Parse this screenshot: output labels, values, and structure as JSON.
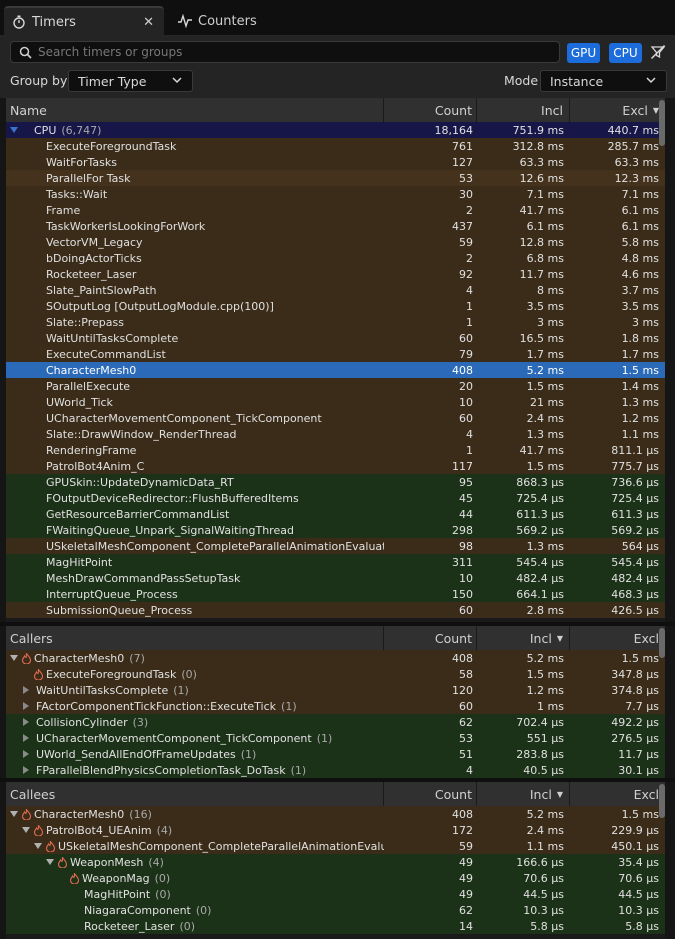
{
  "tabs": [
    {
      "label": "Timers",
      "icon": "stopwatch-icon",
      "active": true
    },
    {
      "label": "Counters",
      "icon": "graph-icon",
      "active": false
    }
  ],
  "toolbar": {
    "search_placeholder": "Search timers or groups",
    "gpu_label": "GPU",
    "cpu_label": "CPU",
    "group_by_label": "Group by",
    "group_by_value": "Timer Type",
    "mode_label": "Mode",
    "mode_value": "Instance"
  },
  "columns": {
    "name": "Name",
    "count": "Count",
    "incl": "Incl",
    "excl": "Excl"
  },
  "timers": {
    "cpu": {
      "name": "CPU",
      "count_label": "(6,747)",
      "count": "18,164",
      "incl": "751.9 ms",
      "excl": "440.7 ms"
    },
    "rows": [
      {
        "name": "ExecuteForegroundTask",
        "count": "761",
        "incl": "312.8 ms",
        "excl": "285.7 ms",
        "tone": "brown"
      },
      {
        "name": "WaitForTasks",
        "count": "127",
        "incl": "63.3 ms",
        "excl": "63.3 ms",
        "tone": "brown"
      },
      {
        "name": "ParallelFor Task",
        "count": "53",
        "incl": "12.6 ms",
        "excl": "12.3 ms",
        "tone": "brown2"
      },
      {
        "name": "Tasks::Wait",
        "count": "30",
        "incl": "7.1 ms",
        "excl": "7.1 ms",
        "tone": "brown"
      },
      {
        "name": "Frame",
        "count": "2",
        "incl": "41.7 ms",
        "excl": "6.1 ms",
        "tone": "brown"
      },
      {
        "name": "TaskWorkerIsLookingForWork",
        "count": "437",
        "incl": "6.1 ms",
        "excl": "6.1 ms",
        "tone": "brown"
      },
      {
        "name": "VectorVM_Legacy",
        "count": "59",
        "incl": "12.8 ms",
        "excl": "5.8 ms",
        "tone": "brown"
      },
      {
        "name": "bDoingActorTicks",
        "count": "2",
        "incl": "6.8 ms",
        "excl": "4.8 ms",
        "tone": "brown"
      },
      {
        "name": "Rocketeer_Laser",
        "count": "92",
        "incl": "11.7 ms",
        "excl": "4.6 ms",
        "tone": "brown"
      },
      {
        "name": "Slate_PaintSlowPath",
        "count": "4",
        "incl": "8 ms",
        "excl": "3.7 ms",
        "tone": "brown"
      },
      {
        "name": "SOutputLog [OutputLogModule.cpp(100)]",
        "count": "1",
        "incl": "3.5 ms",
        "excl": "3.5 ms",
        "tone": "brown"
      },
      {
        "name": "Slate::Prepass",
        "count": "1",
        "incl": "3 ms",
        "excl": "3 ms",
        "tone": "brown"
      },
      {
        "name": "WaitUntilTasksComplete",
        "count": "60",
        "incl": "16.5 ms",
        "excl": "1.8 ms",
        "tone": "brown"
      },
      {
        "name": "ExecuteCommandList",
        "count": "79",
        "incl": "1.7 ms",
        "excl": "1.7 ms",
        "tone": "brown"
      },
      {
        "name": "CharacterMesh0",
        "count": "408",
        "incl": "5.2 ms",
        "excl": "1.5 ms",
        "tone": "sel"
      },
      {
        "name": "ParallelExecute",
        "count": "20",
        "incl": "1.5 ms",
        "excl": "1.4 ms",
        "tone": "brown"
      },
      {
        "name": "UWorld_Tick",
        "count": "10",
        "incl": "21 ms",
        "excl": "1.3 ms",
        "tone": "brown"
      },
      {
        "name": "UCharacterMovementComponent_TickComponent",
        "count": "60",
        "incl": "2.4 ms",
        "excl": "1.2 ms",
        "tone": "brown"
      },
      {
        "name": "Slate::DrawWindow_RenderThread",
        "count": "4",
        "incl": "1.3 ms",
        "excl": "1.1 ms",
        "tone": "brown"
      },
      {
        "name": "RenderingFrame",
        "count": "1",
        "incl": "41.7 ms",
        "excl": "811.1 μs",
        "tone": "brown"
      },
      {
        "name": "PatrolBot4Anim_C",
        "count": "117",
        "incl": "1.5 ms",
        "excl": "775.7 μs",
        "tone": "brown"
      },
      {
        "name": "GPUSkin::UpdateDynamicData_RT",
        "count": "95",
        "incl": "868.3 μs",
        "excl": "736.6 μs",
        "tone": "green"
      },
      {
        "name": "FOutputDeviceRedirector::FlushBufferedItems",
        "count": "45",
        "incl": "725.4 μs",
        "excl": "725.4 μs",
        "tone": "green"
      },
      {
        "name": "GetResourceBarrierCommandList",
        "count": "44",
        "incl": "611.3 μs",
        "excl": "611.3 μs",
        "tone": "green"
      },
      {
        "name": "FWaitingQueue_Unpark_SignalWaitingThread",
        "count": "298",
        "incl": "569.2 μs",
        "excl": "569.2 μs",
        "tone": "green"
      },
      {
        "name": "USkeletalMeshComponent_CompleteParallelAnimationEvaluation",
        "count": "98",
        "incl": "1.3 ms",
        "excl": "564 μs",
        "tone": "brown"
      },
      {
        "name": "MagHitPoint",
        "count": "311",
        "incl": "545.4 μs",
        "excl": "545.4 μs",
        "tone": "green"
      },
      {
        "name": "MeshDrawCommandPassSetupTask",
        "count": "10",
        "incl": "482.4 μs",
        "excl": "482.4 μs",
        "tone": "green"
      },
      {
        "name": "InterruptQueue_Process",
        "count": "150",
        "incl": "664.1 μs",
        "excl": "468.3 μs",
        "tone": "green"
      },
      {
        "name": "SubmissionQueue_Process",
        "count": "60",
        "incl": "2.8 ms",
        "excl": "426.5 μs",
        "tone": "brown"
      }
    ]
  },
  "callers": {
    "title": "Callers",
    "rows": [
      {
        "name": "CharacterMesh0",
        "suffix": "(7)",
        "count": "408",
        "incl": "5.2 ms",
        "excl": "1.5 ms",
        "tone": "brown",
        "indent": 0,
        "expander": "down",
        "flame": true
      },
      {
        "name": "ExecuteForegroundTask",
        "suffix": "(0)",
        "count": "58",
        "incl": "1.5 ms",
        "excl": "347.8 μs",
        "tone": "brown",
        "indent": 1,
        "expander": "none",
        "flame": true
      },
      {
        "name": "WaitUntilTasksComplete",
        "suffix": "(1)",
        "count": "120",
        "incl": "1.2 ms",
        "excl": "374.8 μs",
        "tone": "brown",
        "indent": 1,
        "expander": "right",
        "flame": false
      },
      {
        "name": "FActorComponentTickFunction::ExecuteTick",
        "suffix": "(1)",
        "count": "60",
        "incl": "1 ms",
        "excl": "7.7 μs",
        "tone": "brown",
        "indent": 1,
        "expander": "right",
        "flame": false
      },
      {
        "name": "CollisionCylinder",
        "suffix": "(3)",
        "count": "62",
        "incl": "702.4 μs",
        "excl": "492.2 μs",
        "tone": "green",
        "indent": 1,
        "expander": "right",
        "flame": false
      },
      {
        "name": "UCharacterMovementComponent_TickComponent",
        "suffix": "(1)",
        "count": "53",
        "incl": "551 μs",
        "excl": "276.5 μs",
        "tone": "green",
        "indent": 1,
        "expander": "right",
        "flame": false
      },
      {
        "name": "UWorld_SendAllEndOfFrameUpdates",
        "suffix": "(1)",
        "count": "51",
        "incl": "283.8 μs",
        "excl": "11.7 μs",
        "tone": "green",
        "indent": 1,
        "expander": "right",
        "flame": false
      },
      {
        "name": "FParallelBlendPhysicsCompletionTask_DoTask",
        "suffix": "(1)",
        "count": "4",
        "incl": "40.5 μs",
        "excl": "30.1 μs",
        "tone": "green",
        "indent": 1,
        "expander": "right",
        "flame": false
      }
    ]
  },
  "callees": {
    "title": "Callees",
    "rows": [
      {
        "name": "CharacterMesh0",
        "suffix": "(16)",
        "count": "408",
        "incl": "5.2 ms",
        "excl": "1.5 ms",
        "tone": "brown",
        "indent": 0,
        "expander": "down",
        "flame": true
      },
      {
        "name": "PatrolBot4_UEAnim",
        "suffix": "(4)",
        "count": "172",
        "incl": "2.4 ms",
        "excl": "229.9 μs",
        "tone": "brown",
        "indent": 1,
        "expander": "down",
        "flame": true
      },
      {
        "name": "USkeletalMeshComponent_CompleteParallelAnimationEvaluation",
        "suffix": "",
        "count": "59",
        "incl": "1.1 ms",
        "excl": "450.1 μs",
        "tone": "brown",
        "indent": 2,
        "expander": "down",
        "flame": true
      },
      {
        "name": "WeaponMesh",
        "suffix": "(4)",
        "count": "49",
        "incl": "166.6 μs",
        "excl": "35.4 μs",
        "tone": "green",
        "indent": 3,
        "expander": "down",
        "flame": true
      },
      {
        "name": "WeaponMag",
        "suffix": "(0)",
        "count": "49",
        "incl": "70.6 μs",
        "excl": "70.6 μs",
        "tone": "green",
        "indent": 4,
        "expander": "none",
        "flame": true
      },
      {
        "name": "MagHitPoint",
        "suffix": "(0)",
        "count": "49",
        "incl": "44.5 μs",
        "excl": "44.5 μs",
        "tone": "green",
        "indent": 5,
        "expander": "none",
        "flame": false
      },
      {
        "name": "NiagaraComponent",
        "suffix": "(0)",
        "count": "62",
        "incl": "10.3 μs",
        "excl": "10.3 μs",
        "tone": "green",
        "indent": 5,
        "expander": "none",
        "flame": false
      },
      {
        "name": "Rocketeer_Laser",
        "suffix": "(0)",
        "count": "14",
        "incl": "5.8 μs",
        "excl": "5.8 μs",
        "tone": "green",
        "indent": 5,
        "expander": "none",
        "flame": false
      }
    ]
  },
  "colors": {
    "accent": "#1c6ddb",
    "selection": "#2a6ab8",
    "brown_row": "#3a2c18",
    "green_row": "#1c3218",
    "cpu_row": "#161748"
  }
}
